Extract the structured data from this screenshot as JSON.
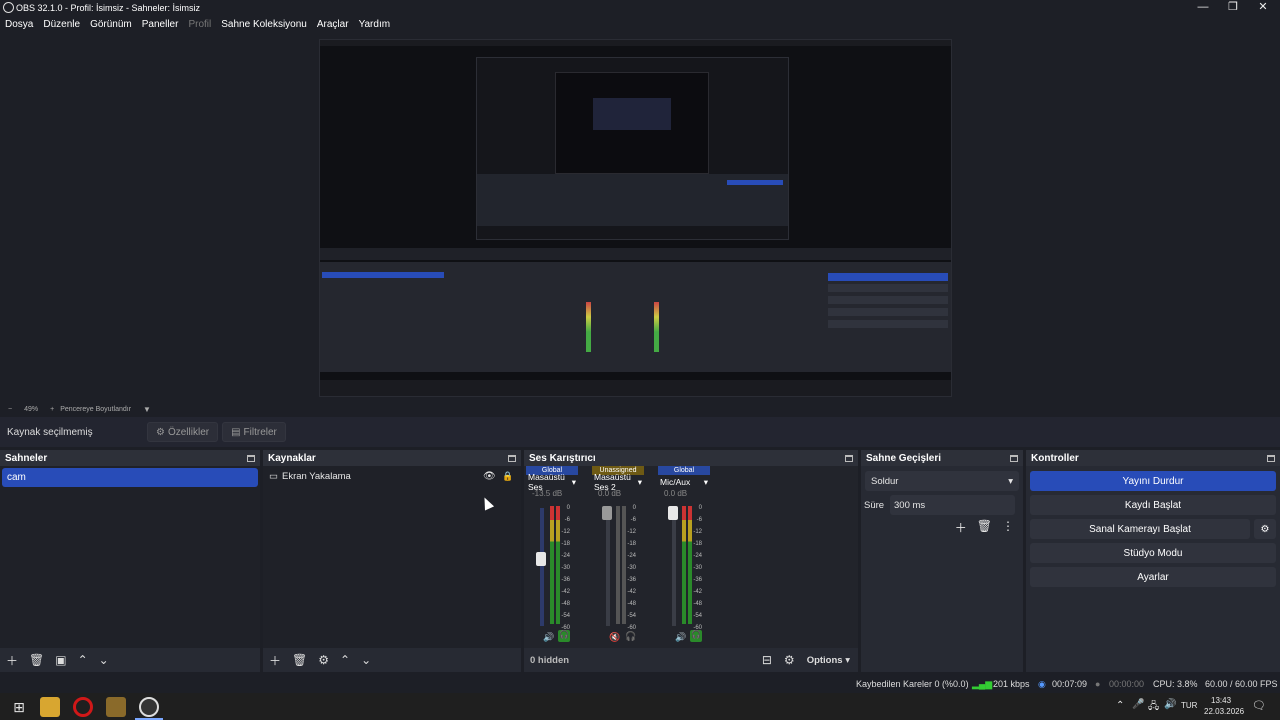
{
  "window": {
    "title": "OBS 32.1.0 - Profil: İsimsiz - Sahneler: İsimsiz",
    "controls": [
      "—",
      "❐",
      "✕"
    ]
  },
  "menu": [
    "Dosya",
    "Düzenle",
    "Görünüm",
    "Paneller",
    "Profil",
    "Sahne Koleksiyonu",
    "Araçlar",
    "Yardım"
  ],
  "preview_toolbar": {
    "minus": "−",
    "zoom": "49%",
    "plus": "+",
    "fit": "Pencereye Boyutlandır"
  },
  "source_bar": {
    "label": "Kaynak seçilmemiş",
    "properties": "Özellikler",
    "filters": "Filtreler"
  },
  "scenes": {
    "title": "Sahneler",
    "items": [
      "cam"
    ]
  },
  "sources": {
    "title": "Kaynaklar",
    "items": [
      "Ekran Yakalama"
    ]
  },
  "mixer": {
    "title": "Ses Karıştırıcı",
    "channels": [
      {
        "tag": "Global",
        "name": "Masaüstü Ses",
        "db": "-13.5 dB",
        "tag_color": "#2848a0"
      },
      {
        "tag": "Unassigned",
        "name": "Masaüstü Ses 2",
        "db": "0.0 dB",
        "tag_color": "#6e5a14"
      },
      {
        "tag": "Global",
        "name": "Mic/Aux",
        "db": "0.0 dB",
        "tag_color": "#2848a0"
      }
    ],
    "ticks": [
      "0",
      "-6",
      "-12",
      "-18",
      "-24",
      "-30",
      "-36",
      "-42",
      "-48",
      "-54",
      "-60"
    ],
    "hidden": "0 hidden",
    "options": "Options"
  },
  "transitions": {
    "title": "Sahne Geçişleri",
    "selected": "Soldur",
    "duration_label": "Süre",
    "duration": "300 ms"
  },
  "controls": {
    "title": "Kontroller",
    "buttons": [
      "Yayını Durdur",
      "Kaydı Başlat",
      "Sanal Kamerayı Başlat",
      "Stüdyo Modu",
      "Ayarlar"
    ]
  },
  "status": {
    "dropped": "Kaybedilen Kareler 0 (%0.0)",
    "bitrate": "201 kbps",
    "stream_time": "00:07:09",
    "rec_time": "00:00:00",
    "cpu": "CPU: 3.8%",
    "fps": "60.00 / 60.00 FPS"
  },
  "taskbar": {
    "lang": "TUR",
    "time": "13:43",
    "date": "22.03.2026"
  },
  "colors": {
    "accent": "#284cb8",
    "dock_bg": "#272a33",
    "panel_bg": "#1f2128"
  }
}
